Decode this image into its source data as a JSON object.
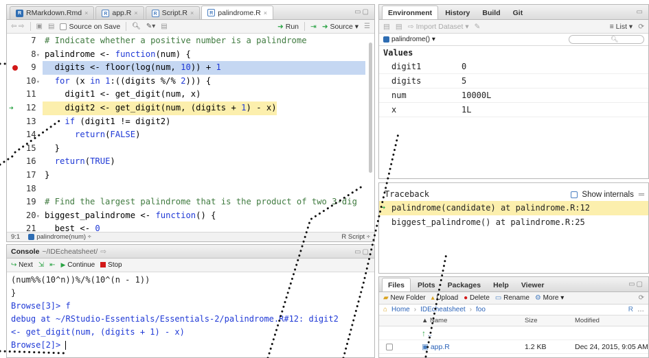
{
  "editor": {
    "tabs": [
      {
        "label": "RMarkdown.Rmd",
        "type": "rmd",
        "close": "×"
      },
      {
        "label": "app.R",
        "type": "r",
        "close": "×"
      },
      {
        "label": "Script.R",
        "type": "r",
        "close": "×"
      },
      {
        "label": "palindrome.R",
        "type": "r",
        "close": "×",
        "active": true
      }
    ],
    "toolbar": {
      "source_on_save": "Source on Save",
      "run": "Run",
      "source": "Source"
    },
    "lines": [
      {
        "n": "7",
        "html": "<span class='cm'># Indicate whether a positive number is a palindrome</span>"
      },
      {
        "n": "8",
        "fold": true,
        "html": "palindrome &lt;- <span class='kw'>function</span>(num) {"
      },
      {
        "n": "9",
        "bp": true,
        "hl": "blue",
        "html": "  digits &lt;- floor(log(num, <span class='num'>10</span>)) + <span class='num'>1</span>"
      },
      {
        "n": "10",
        "fold": true,
        "html": "  <span class='kw'>for</span> (x <span class='kw'>in</span> <span class='num'>1</span>:((digits %/% <span class='num'>2</span>))) {"
      },
      {
        "n": "11",
        "html": "    digit1 &lt;- get_digit(num, x)"
      },
      {
        "n": "12",
        "arrow": true,
        "hl": "yellow",
        "html": "    digit2 &lt;- get_digit(num, (digits + <span class='num'>1</span>) - x)"
      },
      {
        "n": "13",
        "html": "    <span class='kw'>if</span> (digit1 != digit2)"
      },
      {
        "n": "14",
        "html": "      <span class='kw'>return</span>(<span class='kw'>FALSE</span>)"
      },
      {
        "n": "15",
        "html": "  }"
      },
      {
        "n": "16",
        "html": "  <span class='kw'>return</span>(<span class='kw'>TRUE</span>)"
      },
      {
        "n": "17",
        "html": "}"
      },
      {
        "n": "18",
        "html": ""
      },
      {
        "n": "19",
        "html": "<span class='cm'># Find the largest palindrome that is the product of two 3-dig</span>"
      },
      {
        "n": "20",
        "fold": true,
        "html": "biggest_palindrome &lt;- <span class='kw'>function</span>() {"
      },
      {
        "n": "21",
        "html": "  best &lt;- <span class='num'>0</span>"
      }
    ],
    "status": {
      "position": "9:1",
      "scope": "palindrome(num) ÷",
      "lang": "R Script ÷"
    }
  },
  "console": {
    "title": "Console",
    "path": "~/IDEcheatsheet/",
    "debug_buttons": {
      "next": "Next",
      "continue": "Continue",
      "stop": "Stop"
    },
    "lines": [
      {
        "text": "    (num%%(10^n))%/%(10^(n - 1))",
        "cls": ""
      },
      {
        "text": "}",
        "cls": ""
      },
      {
        "text": "Browse[3]> f",
        "cls": "prompt"
      },
      {
        "text": "debug at ~/RStudio-Essentials/Essentials-2/palindrome.R#12: digit2",
        "cls": "prompt"
      },
      {
        "text": "<- get_digit(num, (digits + 1) - x)",
        "cls": "prompt"
      }
    ],
    "prompt": "Browse[2]>"
  },
  "environment": {
    "tabs": [
      "Environment",
      "History",
      "Build",
      "Git"
    ],
    "import_label": "Import Dataset ▾",
    "list_label": "List ▾",
    "scope_label": "palindrome() ▾",
    "section": "Values",
    "rows": [
      {
        "name": "digit1",
        "value": "0"
      },
      {
        "name": "digits",
        "value": "5"
      },
      {
        "name": "num",
        "value": "10000L"
      },
      {
        "name": "x",
        "value": "1L"
      }
    ]
  },
  "traceback": {
    "title": "Traceback",
    "show_internals": "Show internals",
    "frames": [
      {
        "text": "palindrome(candidate) at palindrome.R:12",
        "current": true
      },
      {
        "text": "biggest_palindrome() at palindrome.R:25",
        "current": false
      }
    ]
  },
  "files": {
    "tabs": [
      "Files",
      "Plots",
      "Packages",
      "Help",
      "Viewer"
    ],
    "toolbar": {
      "new_folder": "New Folder",
      "upload": "Upload",
      "delete": "Delete",
      "rename": "Rename",
      "more": "More ▾"
    },
    "breadcrumb": [
      "Home",
      "IDEcheatsheet",
      "foo"
    ],
    "columns": {
      "name": "▲ Name",
      "size": "Size",
      "modified": "Modified"
    },
    "rows": [
      {
        "name": "..",
        "size": "",
        "modified": "",
        "up": true
      },
      {
        "name": "app.R",
        "size": "1.2 KB",
        "modified": "Dec 24, 2015, 9:05 AM"
      }
    ]
  }
}
